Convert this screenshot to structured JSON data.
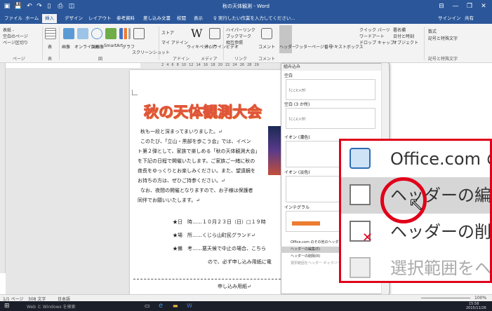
{
  "window": {
    "title": "秋の天体観測 - Word",
    "controls": [
      "⊟",
      "—",
      "❐",
      "✕"
    ]
  },
  "quick_access": [
    "save-icon",
    "undo-icon",
    "redo-icon",
    "new-icon",
    "print-icon",
    "preview-icon"
  ],
  "tabs": [
    {
      "label": "ファイル",
      "active": false
    },
    {
      "label": "ホーム",
      "active": false
    },
    {
      "label": "挿入",
      "active": true
    },
    {
      "label": "デザイン",
      "active": false
    },
    {
      "label": "レイアウト",
      "active": false
    },
    {
      "label": "参考資料",
      "active": false
    },
    {
      "label": "差し込み文書",
      "active": false
    },
    {
      "label": "校閲",
      "active": false
    },
    {
      "label": "表示",
      "active": false
    }
  ],
  "tell_me": "♀ 実行したい作業を入力してください...",
  "account": {
    "signin": "サインイン",
    "share": "共有"
  },
  "ribbon": {
    "pages": {
      "items": [
        "表紙 -",
        "空白のページ",
        "ページ区切り"
      ],
      "group": "ページ"
    },
    "table": {
      "label": "表",
      "group": "表"
    },
    "illustrations": {
      "items": [
        "画像",
        "オンライン画像",
        "図形",
        "SmartArt",
        "グラフ",
        "スクリーンショット"
      ],
      "group": "図"
    },
    "addins": {
      "items": [
        "ストア",
        "マイ アドイン"
      ],
      "group": "アドイン"
    },
    "media": {
      "items": [
        "ウィキペディア",
        "オンラインビデオ"
      ],
      "group": "メディア"
    },
    "links": {
      "items": [
        "ハイパーリンク",
        "ブックマーク",
        "相互参照"
      ],
      "group": "リンク"
    },
    "comments": {
      "label": "コメント",
      "group": "コメント"
    },
    "header_footer": {
      "items": [
        "ヘッダー",
        "フッター",
        "ページ番号"
      ]
    },
    "text": {
      "items": [
        "テキストボックス",
        "クイック パーツ",
        "ワードアート",
        "ドロップ キャップ",
        "署名欄",
        "日付と時刻",
        "オブジェクト"
      ]
    },
    "symbols": {
      "items": [
        "数式",
        "記号と特殊文字"
      ],
      "group": "記号と特殊文字"
    }
  },
  "ruler_numbers": [
    "2",
    "4",
    "6",
    "8",
    "10",
    "12",
    "14",
    "16",
    "18",
    "20",
    "22",
    "24",
    "26",
    "28",
    "29"
  ],
  "document": {
    "title": "秋の天体観測大会",
    "lines": [
      "秋も一段と深まってまいりました。↵",
      "このたび、「立山・黒部を歩こう会」では、イベン",
      "ト第２弾として、家族で楽しめる「秋の天体観測大会」",
      "を下記の日程で開催いたします。ご家族ご一緒に秋の",
      "夜長をゆっくりとお楽しみください。また、望遠鏡を",
      "お持ちの方は、ぜひご持参ください。↵",
      "なお、夜間の開催となりますので、お子様は保護者",
      "同伴でお願いいたします。↵"
    ],
    "items": [
      "★日　時……１０月２３日（日）□１９時",
      "★場　所……くじら山町民グランド↵",
      "★備　考……悪天候で中止の場合、こちら",
      "ので、必ず申し込み用紙に電"
    ],
    "cut_label": "申し込み用紙↵"
  },
  "gallery": {
    "header": "組み込み",
    "entries": [
      {
        "name": "空白",
        "thumb_text": "[ここに入力]"
      },
      {
        "name": "空白 (3 か所)",
        "thumb_text": "[ここに入力]"
      },
      {
        "name": "イオン (濃色)",
        "thumb_text": ""
      },
      {
        "name": "イオン (淡色)",
        "thumb_text": ""
      },
      {
        "name": "インテグラル",
        "thumb_text": ""
      }
    ],
    "menu": [
      "Office.com のその他のヘッダー",
      "ヘッダーの編集(E)",
      "ヘッダーの削除(R)",
      "選択範囲をヘッダー ギャラリーに保存(S)..."
    ]
  },
  "zoom_callout": {
    "rows": [
      "Office.com の",
      "ヘッダーの編集(",
      "ヘッダーの削除(",
      "選択範囲をヘッ"
    ],
    "highlight_color": "#e0001a"
  },
  "status": {
    "page": "1/1 ページ",
    "words": "308 文字",
    "lang": "日本語",
    "zoom": "100%"
  },
  "taskbar": {
    "search": "Web と Windows を検索",
    "time": "15:58",
    "date": "2015/11/26"
  },
  "colors": {
    "accent": "#2b579a",
    "highlight": "#e0001a",
    "title_orange": "#e0553a"
  }
}
